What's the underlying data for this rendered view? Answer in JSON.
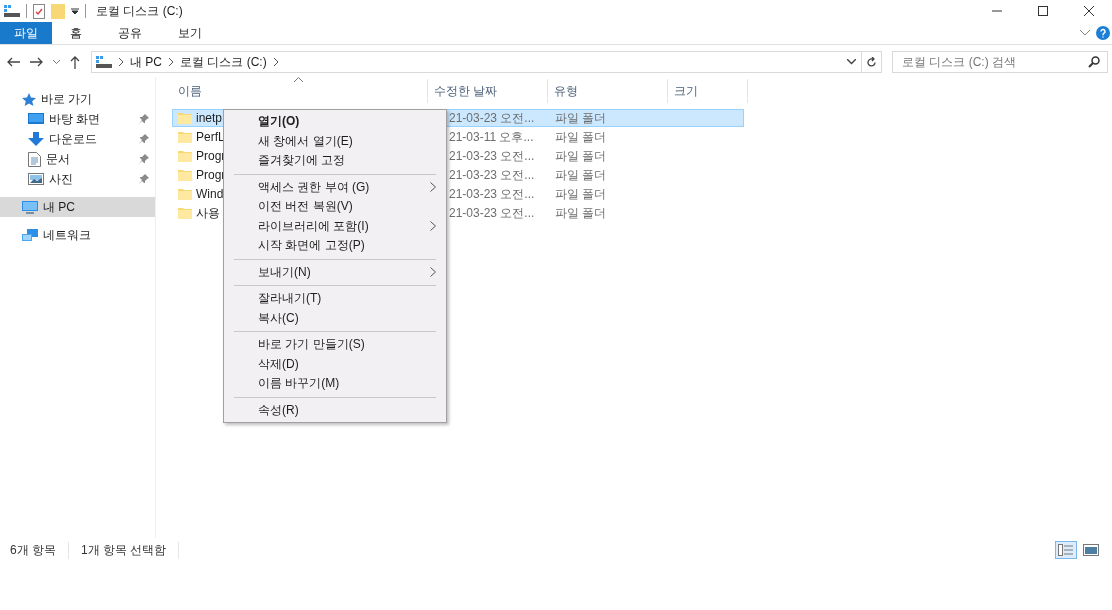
{
  "window": {
    "title": "로컬 디스크 (C:)"
  },
  "ribbon_tabs": [
    {
      "label": "파일",
      "selected": true
    },
    {
      "label": "홈",
      "selected": false
    },
    {
      "label": "공유",
      "selected": false
    },
    {
      "label": "보기",
      "selected": false
    }
  ],
  "address_bar": {
    "crumbs": [
      "내 PC",
      "로컬 디스크 (C:)"
    ]
  },
  "search": {
    "placeholder": "로컬 디스크 (C:) 검색"
  },
  "sidebar": {
    "items": [
      {
        "label": "바로 가기",
        "kind": "star",
        "selected": false,
        "children": [
          {
            "label": "바탕 화면",
            "kind": "desktop",
            "pinned": true,
            "selected": false
          },
          {
            "label": "다운로드",
            "kind": "download",
            "pinned": true,
            "selected": false
          },
          {
            "label": "문서",
            "kind": "document",
            "pinned": true,
            "selected": false
          },
          {
            "label": "사진",
            "kind": "picture",
            "pinned": true,
            "selected": false
          }
        ]
      },
      {
        "label": "내 PC",
        "kind": "pc",
        "selected": true
      },
      {
        "label": "네트워크",
        "kind": "network",
        "selected": false
      }
    ]
  },
  "table": {
    "columns": [
      "이름",
      "수정한 날짜",
      "유형",
      "크기"
    ],
    "rows": [
      {
        "name": "inetp",
        "date": "21-03-23 오전...",
        "type": "파일 폴더",
        "selected": true
      },
      {
        "name": "PerfL",
        "date": "21-03-11 오후...",
        "type": "파일 폴더",
        "selected": false
      },
      {
        "name": "Progr",
        "date": "21-03-23 오전...",
        "type": "파일 폴더",
        "selected": false
      },
      {
        "name": "Progr",
        "date": "21-03-23 오전...",
        "type": "파일 폴더",
        "selected": false
      },
      {
        "name": "Wind",
        "date": "21-03-23 오전...",
        "type": "파일 폴더",
        "selected": false
      },
      {
        "name": "사용",
        "date": "21-03-23 오전...",
        "type": "파일 폴더",
        "selected": false
      }
    ]
  },
  "context_menu": {
    "groups": [
      [
        {
          "label": "열기(O)",
          "bold": true,
          "submenu": false
        },
        {
          "label": "새 창에서 열기(E)",
          "bold": false,
          "submenu": false
        },
        {
          "label": "즐겨찾기에 고정",
          "bold": false,
          "submenu": false
        }
      ],
      [
        {
          "label": "액세스 권한 부여 (G)",
          "bold": false,
          "submenu": true
        },
        {
          "label": "이전 버전 복원(V)",
          "bold": false,
          "submenu": false
        },
        {
          "label": "라이브러리에 포함(I)",
          "bold": false,
          "submenu": true
        },
        {
          "label": "시작 화면에 고정(P)",
          "bold": false,
          "submenu": false
        }
      ],
      [
        {
          "label": "보내기(N)",
          "bold": false,
          "submenu": true
        }
      ],
      [
        {
          "label": "잘라내기(T)",
          "bold": false,
          "submenu": false
        },
        {
          "label": "복사(C)",
          "bold": false,
          "submenu": false
        }
      ],
      [
        {
          "label": "바로 가기 만들기(S)",
          "bold": false,
          "submenu": false
        },
        {
          "label": "삭제(D)",
          "bold": false,
          "submenu": false
        },
        {
          "label": "이름 바꾸기(M)",
          "bold": false,
          "submenu": false
        }
      ],
      [
        {
          "label": "속성(R)",
          "bold": false,
          "submenu": false
        }
      ]
    ]
  },
  "status_bar": {
    "items": [
      "6개 항목",
      "1개 항목 선택함"
    ]
  },
  "view_buttons": [
    {
      "kind": "details",
      "selected": true
    },
    {
      "kind": "large_icons",
      "selected": false
    }
  ]
}
